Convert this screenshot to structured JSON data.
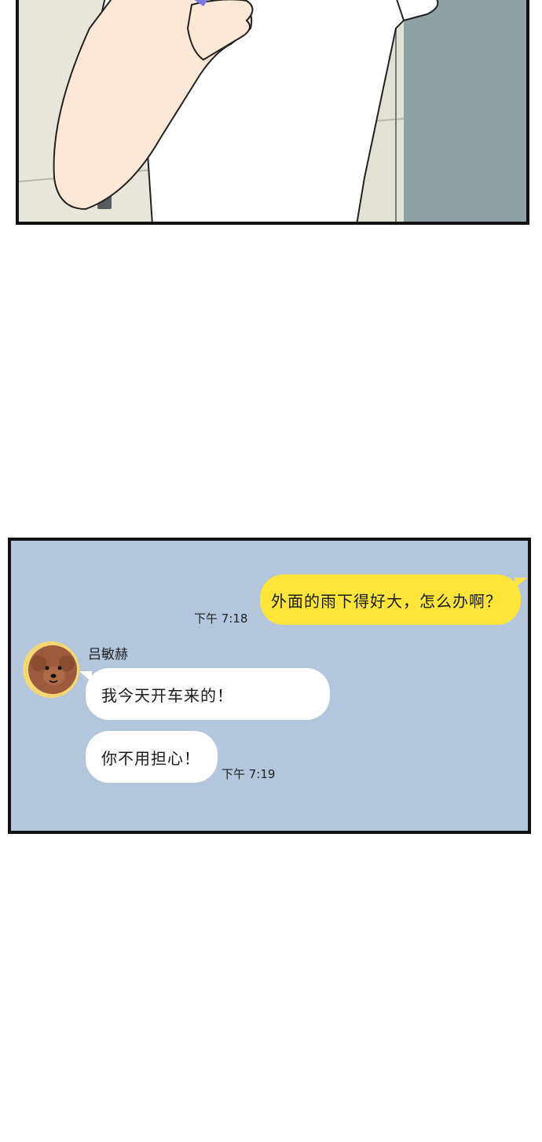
{
  "chat": {
    "sent_message": "外面的雨下得好大，怎么办啊？",
    "sent_time": "下午 7:18",
    "sender_name": "吕敏赫",
    "received_messages": [
      "我今天开车来的！",
      "你不用担心！"
    ],
    "received_time": "下午 7:19",
    "avatar": "poodle-dog-avatar-icon"
  },
  "colors": {
    "chat_background": "#b3c6db",
    "sent_bubble": "#ffe53a",
    "received_bubble": "#ffffff",
    "panel_border": "#111111"
  }
}
